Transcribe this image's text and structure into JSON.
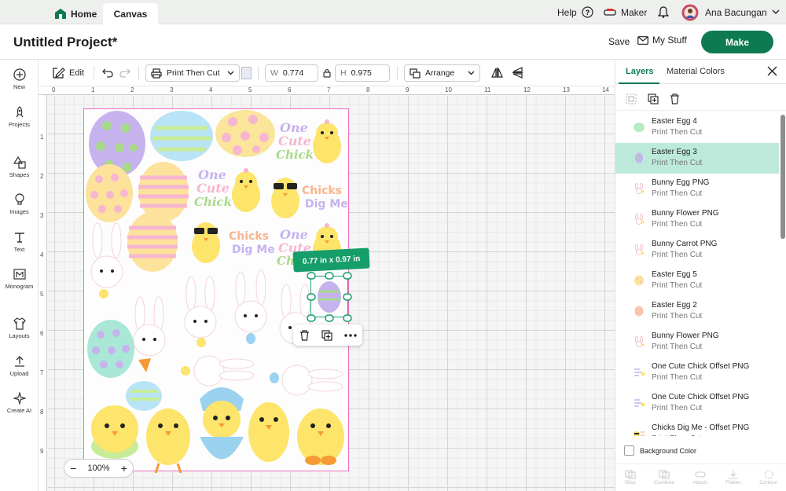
{
  "topbar": {
    "home_label": "Home",
    "canvas_label": "Canvas",
    "help_label": "Help",
    "maker_label": "Maker",
    "user_name": "Ana Bacungan"
  },
  "header": {
    "project_title": "Untitled Project*",
    "save_label": "Save",
    "mystuff_label": "My Stuff",
    "make_label": "Make"
  },
  "sidebar": {
    "items": [
      {
        "label": "New",
        "icon": "plus-circle-icon"
      },
      {
        "label": "Projects",
        "icon": "rocket-icon"
      },
      {
        "label": "Shapes",
        "icon": "shapes-icon"
      },
      {
        "label": "Images",
        "icon": "lightbulb-icon"
      },
      {
        "label": "Text",
        "icon": "text-icon"
      },
      {
        "label": "Monogram",
        "icon": "monogram-icon"
      },
      {
        "label": "Layouts",
        "icon": "shirt-icon"
      },
      {
        "label": "Upload",
        "icon": "upload-icon"
      },
      {
        "label": "Create AI",
        "icon": "sparkle-icon"
      }
    ]
  },
  "toolbar": {
    "edit_label": "Edit",
    "operation_label": "Print Then Cut",
    "width_label": "W",
    "width_value": "0.774",
    "height_label": "H",
    "height_value": "0.975",
    "arrange_label": "Arrange"
  },
  "canvas": {
    "ruler_top": [
      "0",
      "1",
      "2",
      "3",
      "4",
      "5",
      "6",
      "7",
      "8",
      "9",
      "10",
      "11",
      "12",
      "13",
      "14"
    ],
    "ruler_left": [
      "1",
      "2",
      "3",
      "4",
      "5",
      "6",
      "7",
      "8",
      "9"
    ],
    "size_tag": "0.77  in x 0.97  in",
    "zoom_level": "100%"
  },
  "panel": {
    "tab_layers": "Layers",
    "tab_material": "Material Colors",
    "layers": [
      {
        "name": "Easter Egg 4",
        "op": "Print Then Cut",
        "thumb": "green-egg",
        "selected": false
      },
      {
        "name": "Easter Egg 3",
        "op": "Print Then Cut",
        "thumb": "purple-egg",
        "selected": true
      },
      {
        "name": "Bunny Egg PNG",
        "op": "Print Then Cut",
        "thumb": "bunny",
        "selected": false
      },
      {
        "name": "Bunny Flower PNG",
        "op": "Print Then Cut",
        "thumb": "bunny",
        "selected": false
      },
      {
        "name": "Bunny Carrot PNG",
        "op": "Print Then Cut",
        "thumb": "bunny",
        "selected": false
      },
      {
        "name": "Easter Egg 5",
        "op": "Print Then Cut",
        "thumb": "yellow-egg",
        "selected": false
      },
      {
        "name": "Easter Egg 2",
        "op": "Print Then Cut",
        "thumb": "peach-egg",
        "selected": false
      },
      {
        "name": "Bunny Flower PNG",
        "op": "Print Then Cut",
        "thumb": "bunny",
        "selected": false
      },
      {
        "name": "One Cute Chick Offset PNG",
        "op": "Print Then Cut",
        "thumb": "text",
        "selected": false
      },
      {
        "name": "One Cute Chick Offset PNG",
        "op": "Print Then Cut",
        "thumb": "text",
        "selected": false
      },
      {
        "name": "Chicks Dig Me - Offset PNG",
        "op": "Print Then Cut",
        "thumb": "chick",
        "selected": false
      }
    ],
    "background_color_label": "Background Color",
    "bottom_actions": [
      "Slice",
      "Combine",
      "Attach",
      "Flatten",
      "Contour"
    ]
  },
  "colors": {
    "brand_green": "#0e7a52",
    "selected_row": "#bde9da",
    "mat_border": "#f06fbe",
    "size_tag": "#159d6a"
  }
}
